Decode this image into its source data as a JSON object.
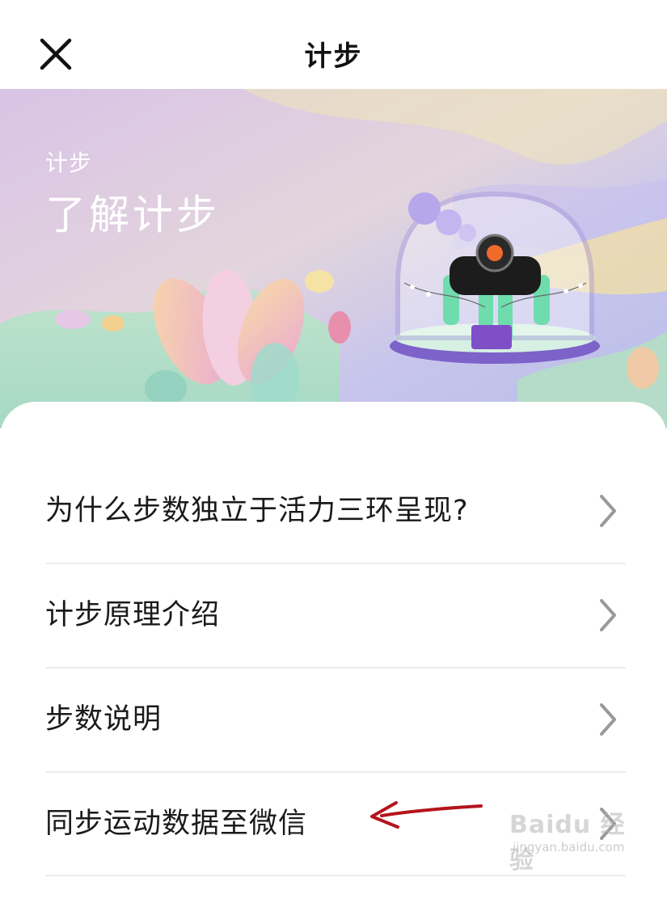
{
  "header": {
    "title": "计步"
  },
  "banner": {
    "subtitle": "计步",
    "title": "了解计步"
  },
  "menu": {
    "items": [
      {
        "label": "为什么步数独立于活力三环呈现?"
      },
      {
        "label": "计步原理介绍"
      },
      {
        "label": "步数说明"
      },
      {
        "label": "同步运动数据至微信"
      }
    ]
  },
  "watermark": {
    "logo": "Baidu 经验",
    "url": "jingyan.baidu.com"
  },
  "colors": {
    "annotation_arrow": "#b4141c",
    "chevron": "#9a9a9a",
    "divider": "#ececec"
  },
  "icons": [
    "close-icon",
    "chevron-right-icon",
    "watch-illustration"
  ]
}
